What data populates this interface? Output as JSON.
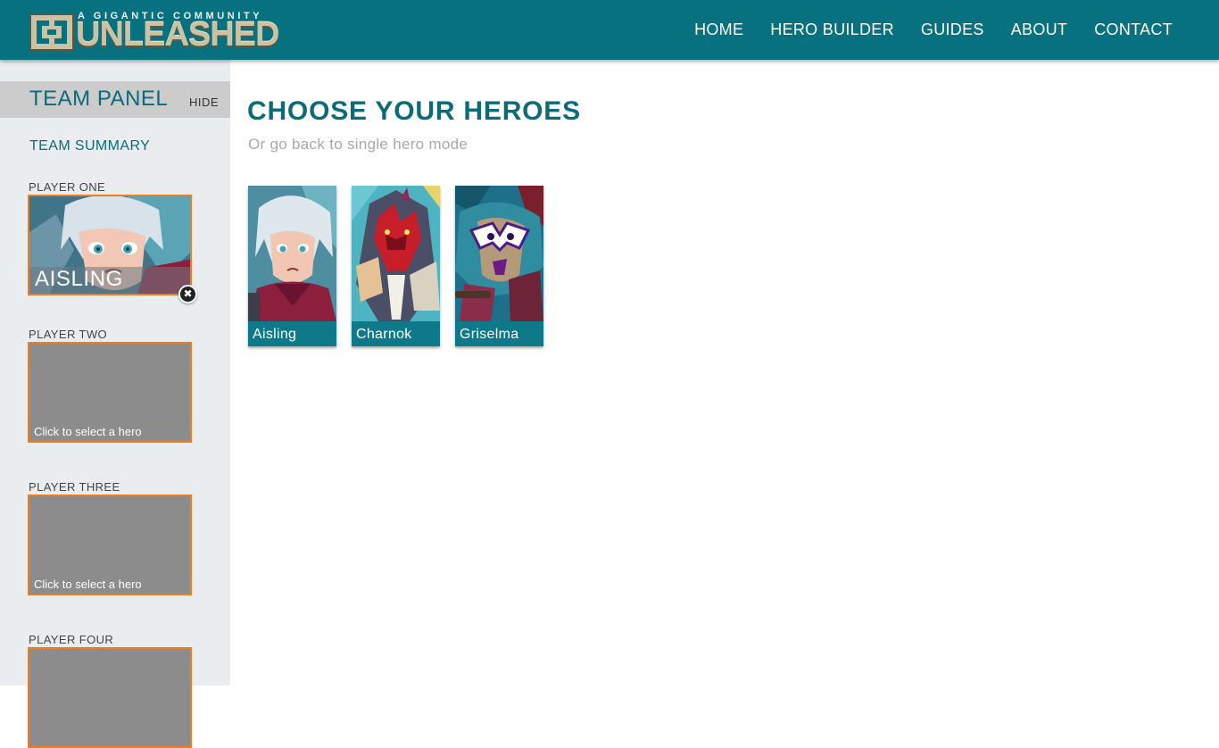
{
  "header": {
    "logo_small": "A GIGANTIC COMMUNITY",
    "logo_big": "UNLEASHED",
    "nav": [
      "HOME",
      "HERO BUILDER",
      "GUIDES",
      "ABOUT",
      "CONTACT"
    ]
  },
  "sidebar": {
    "title": "TEAM PANEL",
    "hide": "HIDE",
    "summary": "TEAM SUMMARY",
    "players": [
      {
        "label": "PLAYER ONE",
        "hero": "AISLING"
      },
      {
        "label": "PLAYER TWO",
        "hint": "Click to select a hero"
      },
      {
        "label": "PLAYER THREE",
        "hint": "Click to select a hero"
      },
      {
        "label": "PLAYER FOUR"
      }
    ]
  },
  "main": {
    "title": "CHOOSE YOUR HEROES",
    "subtitle": "Or go back to single hero mode",
    "heroes": [
      "Aisling",
      "Charnok",
      "Griselma"
    ]
  },
  "colors": {
    "header_bg": "#08717f",
    "accent_teal": "#0d6b78",
    "slot_border": "#f07c1c",
    "sidebar_bg": "#e9edf0"
  }
}
